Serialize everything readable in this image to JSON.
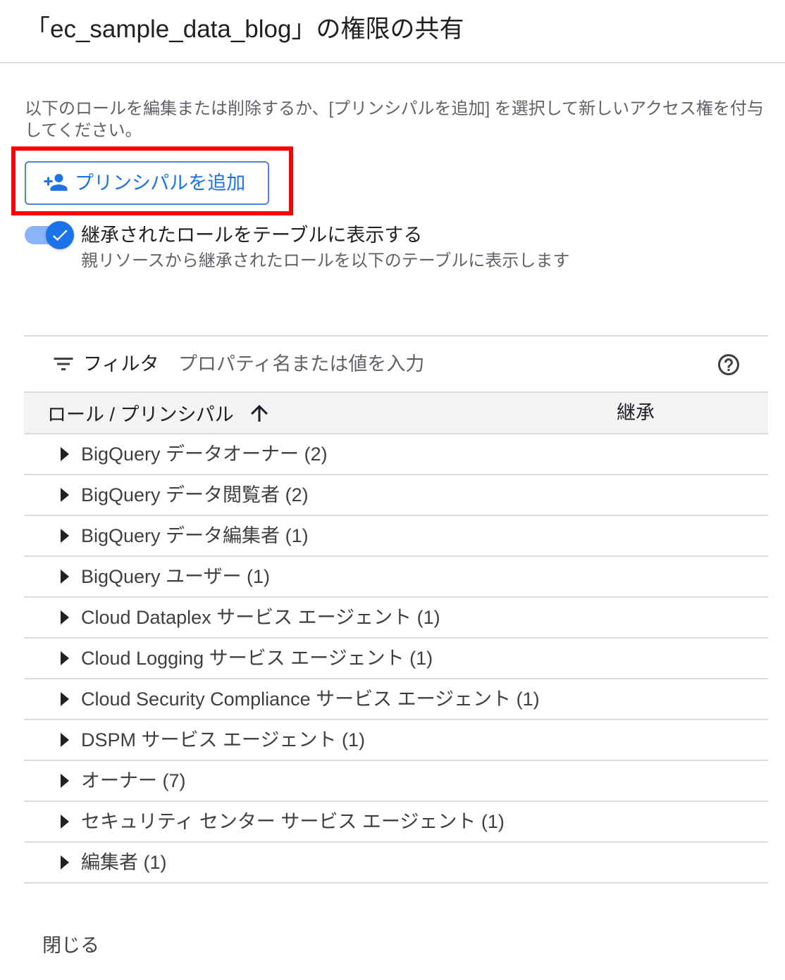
{
  "dialog": {
    "title": "「ec_sample_data_blog」の権限の共有",
    "description": "以下のロールを編集または削除するか、[プリンシパルを追加] を選択して新しいアクセス権を付与してください。",
    "add_principal_button": {
      "label": "プリンシパルを追加",
      "icon": "person-add-icon"
    },
    "show_inherited_toggle": {
      "label": "継承されたロールをテーブルに表示する",
      "sublabel": "親リソースから継承されたロールを以下のテーブルに表示します",
      "checked": true,
      "icon": "check-icon"
    },
    "filter": {
      "icon": "filter-list-icon",
      "label": "フィルタ",
      "value": "",
      "placeholder": "プロパティ名または値を入力",
      "help_icon": "help-outline-icon"
    },
    "table": {
      "columns": [
        {
          "label": "ロール / プリンシパル",
          "sort": "ascending",
          "sort_icon": "arrow-upward-icon"
        },
        {
          "label": "継承"
        }
      ],
      "row_expand_icon": "arrow-right-icon",
      "rows": [
        {
          "role": "BigQuery データオーナー",
          "count": "(2)",
          "expanded": false
        },
        {
          "role": "BigQuery データ閲覧者",
          "count": "(2)",
          "expanded": false
        },
        {
          "role": "BigQuery データ編集者",
          "count": "(1)",
          "expanded": false
        },
        {
          "role": "BigQuery ユーザー",
          "count": "(1)",
          "expanded": false
        },
        {
          "role": "Cloud Dataplex サービス エージェント",
          "count": "(1)",
          "expanded": false
        },
        {
          "role": "Cloud Logging サービス エージェント",
          "count": "(1)",
          "expanded": false
        },
        {
          "role": "Cloud Security Compliance サービス エージェント",
          "count": "(1)",
          "expanded": false
        },
        {
          "role": "DSPM サービス エージェント",
          "count": "(1)",
          "expanded": false
        },
        {
          "role": "オーナー",
          "count": "(7)",
          "expanded": false
        },
        {
          "role": "セキュリティ センター サービス エージェント",
          "count": "(1)",
          "expanded": false
        },
        {
          "role": "編集者",
          "count": "(1)",
          "expanded": false
        }
      ]
    },
    "close_button": {
      "label": "閉じる"
    }
  },
  "colors": {
    "accent": "#1a73e8",
    "toggle_track": "#8ab4f8",
    "button_border": "#4d84d6",
    "highlight_annotation": "#ff0000",
    "text_primary": "#202124",
    "text_body": "#3c4043",
    "text_secondary": "#5f6368",
    "divider": "#dadce0",
    "header_background": "#f1f3f4"
  }
}
